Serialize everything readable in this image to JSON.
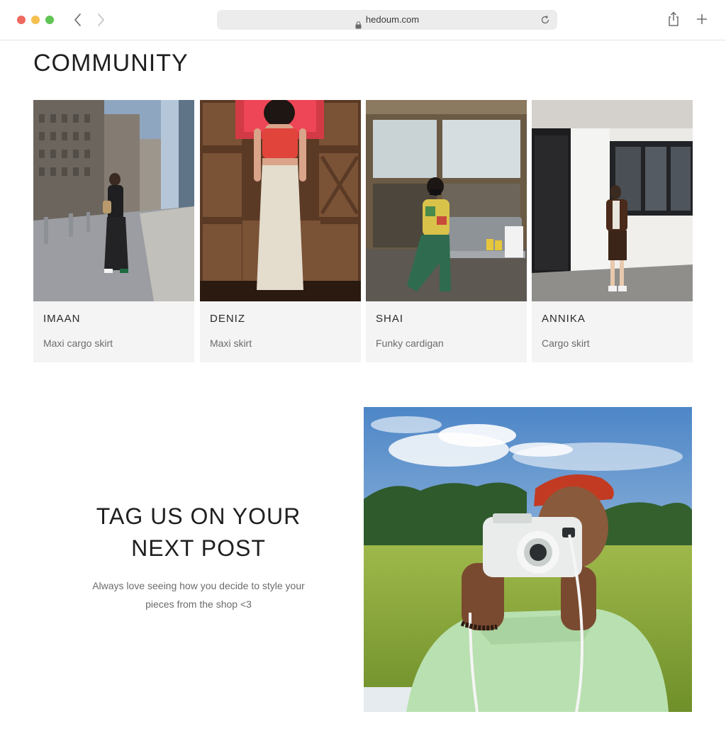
{
  "browser": {
    "url": "hedoum.com"
  },
  "community": {
    "title": "COMMUNITY",
    "cards": [
      {
        "name": "IMAAN",
        "item": "Maxi cargo skirt"
      },
      {
        "name": "DENIZ",
        "item": "Maxi skirt"
      },
      {
        "name": "SHAI",
        "item": "Funky cardigan"
      },
      {
        "name": "ANNIKA",
        "item": "Cargo skirt"
      }
    ]
  },
  "tag_section": {
    "heading_line1": "TAG US ON YOUR",
    "heading_line2": "NEXT POST",
    "text_line1": "Always love seeing how you decide to style your",
    "text_line2": "pieces from the shop <3"
  },
  "icons": [
    "back-chevron-icon",
    "forward-chevron-icon",
    "lock-icon",
    "reload-icon",
    "share-icon",
    "plus-icon"
  ],
  "colors": {
    "close": "#ed6a5e",
    "minimize": "#f5bf4f",
    "zoom": "#61c554",
    "card_background": "#f4f4f4"
  }
}
